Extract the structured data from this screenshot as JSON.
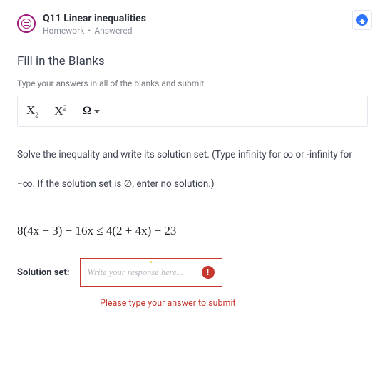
{
  "header": {
    "title": "Q11 Linear inequalities",
    "type": "Homework",
    "status": "Answered"
  },
  "section": {
    "title": "Fill in the Blanks",
    "hint": "Type your answers in all of the blanks and submit"
  },
  "toolbar": {
    "subscript": "X",
    "subscript_sub": "2",
    "superscript": "X",
    "superscript_sup": "2",
    "special": "Ω"
  },
  "prompt": {
    "line1": "Solve the inequality and write its solution set. (Type infinity for ∞ or -infinity for",
    "line2": "−∞. If the solution set is ∅, enter no solution.)"
  },
  "equation": "8(4x − 3) − 16x ≤ 4(2 + 4x) − 23",
  "answer": {
    "label": "Solution set:",
    "placeholder": "Write your response here...",
    "alert_char": "!",
    "error": "Please type your answer to submit"
  }
}
